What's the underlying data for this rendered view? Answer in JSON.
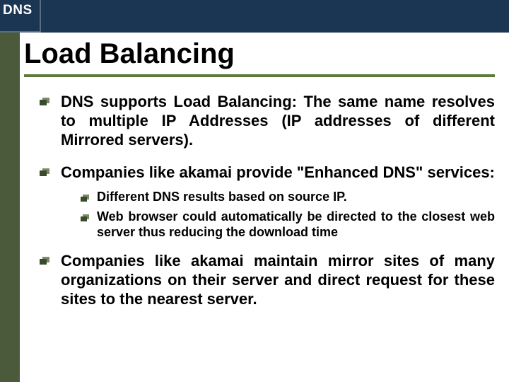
{
  "header": {
    "label": "DNS"
  },
  "title": "Load Balancing",
  "bullets": {
    "b1": "DNS supports Load Balancing: The same name resolves to multiple IP Addresses (IP addresses of different Mirrored servers).",
    "b2": "Companies like akamai provide \"Enhanced DNS\" services:",
    "b2_sub1": "Different DNS results based on source IP.",
    "b2_sub2": "Web browser could automatically be directed to the closest web server thus reducing the download time",
    "b3": "Companies like akamai maintain mirror sites of many organizations on their server and direct request for these sites to the nearest server."
  }
}
